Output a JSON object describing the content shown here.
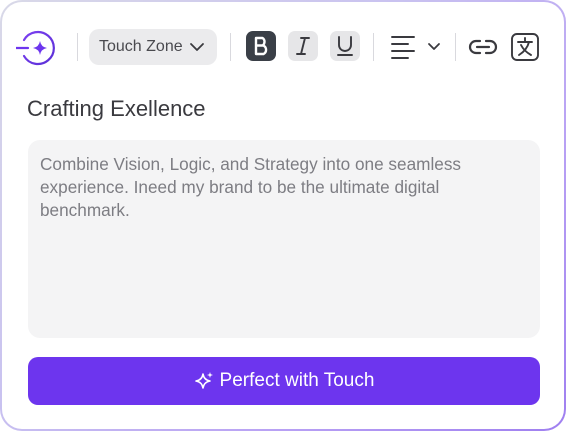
{
  "toolbar": {
    "zone_label": "Touch Zone",
    "logo_icon": "compass-sparkle-icon",
    "format_buttons": [
      {
        "name": "bold",
        "label": "B"
      },
      {
        "name": "italic",
        "label": "I"
      },
      {
        "name": "underline",
        "label": "U"
      }
    ],
    "align_icon": "align-left-icon",
    "link_icon": "link-icon",
    "translate_icon": "translate-icon"
  },
  "editor": {
    "title": "Crafting Exellence",
    "body_text": "Combine Vision, Logic, and Strategy into one seamless experience. Ineed my brand to be the ultimate digital benchmark."
  },
  "action": {
    "label": "Perfect with Touch",
    "icon": "sparkle-icon"
  },
  "colors": {
    "accent": "#6d35ee",
    "bold_active": "#3a3f47",
    "field_bg": "#f4f4f5"
  }
}
